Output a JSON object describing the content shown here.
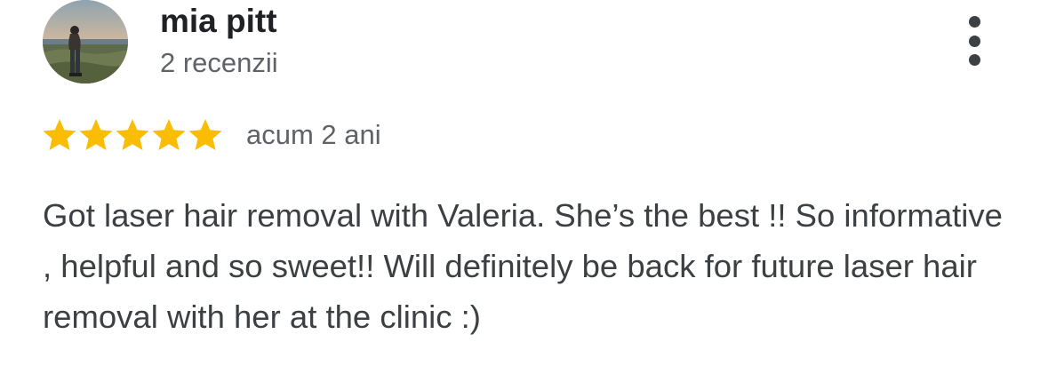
{
  "review": {
    "author_name": "mia pitt",
    "author_meta": "2 recenzii",
    "rating": 5,
    "rating_max": 5,
    "star_color": "#fbbc04",
    "date": "acum 2 ani",
    "text": "Got laser hair removal with Valeria. She’s the best !! So informative , helpful and so sweet!! Will definitely be back for future laser hair removal with her at the clinic :)",
    "more_icon": "more-vert-icon"
  }
}
